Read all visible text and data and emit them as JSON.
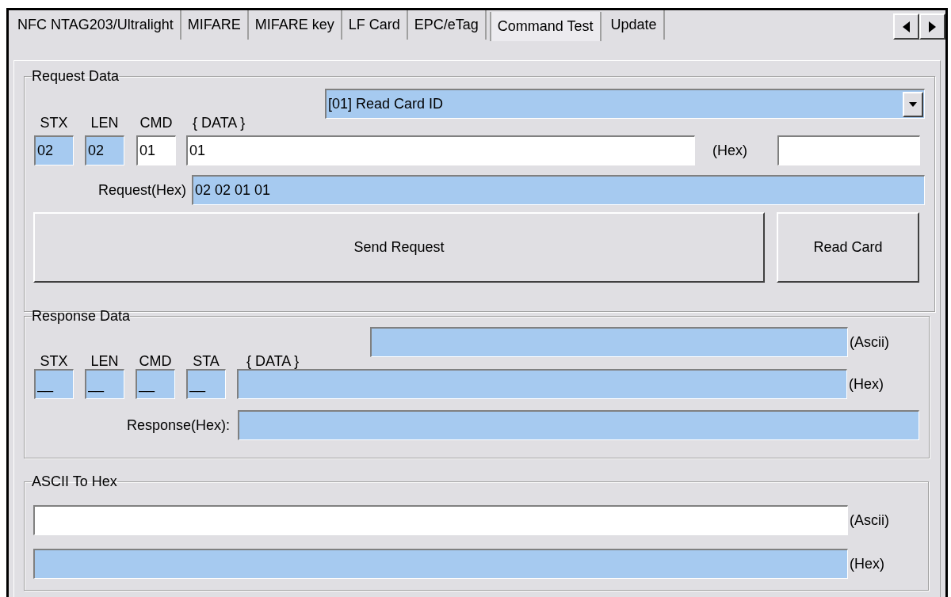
{
  "tabs": [
    {
      "label": "NFC NTAG203/Ultralight",
      "selected": false
    },
    {
      "label": "MIFARE",
      "selected": false
    },
    {
      "label": "MIFARE key",
      "selected": false
    },
    {
      "label": "LF Card",
      "selected": false
    },
    {
      "label": "EPC/eTag",
      "selected": false
    },
    {
      "label": "Command Test",
      "selected": true
    },
    {
      "label": "Update",
      "selected": false
    }
  ],
  "request": {
    "title": "Request Data",
    "command": "[01] Read Card ID",
    "labels": [
      "STX",
      "LEN",
      "CMD",
      "{ DATA }"
    ],
    "fields": [
      {
        "value": "02",
        "readonly": true
      },
      {
        "value": "02",
        "readonly": true
      },
      {
        "value": "01",
        "readonly": false
      },
      {
        "value": "01",
        "readonly": false
      }
    ],
    "hex_label": "(Hex)",
    "extra_field": {
      "readonly": false
    },
    "request_label": "Request(Hex)",
    "request_field": {
      "value": "02 02 01 01",
      "readonly": true
    },
    "buttons": [
      "Send Request",
      "Read Card"
    ]
  },
  "response": {
    "title": "Response Data",
    "ascii_field": {
      "readonly": true
    },
    "ascii_label": "(Ascii)",
    "labels": [
      "STX",
      "LEN",
      "CMD",
      "STA",
      "{ DATA }"
    ],
    "fields": [
      {
        "value": "__",
        "readonly": true
      },
      {
        "value": "__",
        "readonly": true
      },
      {
        "value": "__",
        "readonly": true
      },
      {
        "value": "__",
        "readonly": true
      }
    ],
    "data_field": {
      "readonly": true
    },
    "hex_label": "(Hex)",
    "response_label": "Response(Hex):",
    "response_field": {
      "readonly": true
    }
  },
  "ascii_to_hex": {
    "title": "ASCII To Hex",
    "ascii_field": {
      "readonly": false
    },
    "ascii_label": "(Ascii)",
    "hex_field": {
      "readonly": true
    },
    "hex_label": "(Hex)"
  }
}
